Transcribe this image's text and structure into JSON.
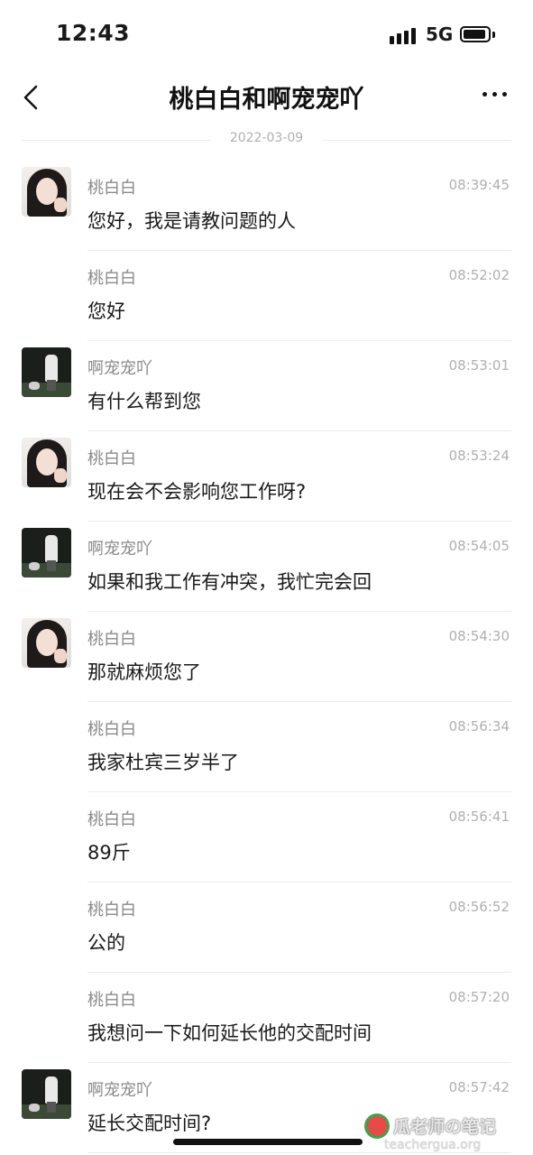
{
  "status_bar": {
    "time": "12:43",
    "network": "5G"
  },
  "header": {
    "title": "桃白白和啊宠宠吖"
  },
  "date_divider": "2022-03-09",
  "messages": [
    {
      "sender": "桃白白",
      "time": "08:39:45",
      "text": "您好，我是请教问题的人",
      "avatar": "a"
    },
    {
      "sender": "桃白白",
      "time": "08:52:02",
      "text": "您好",
      "avatar": ""
    },
    {
      "sender": "啊宠宠吖",
      "time": "08:53:01",
      "text": "有什么帮到您",
      "avatar": "b"
    },
    {
      "sender": "桃白白",
      "time": "08:53:24",
      "text": "现在会不会影响您工作呀?",
      "avatar": "a"
    },
    {
      "sender": "啊宠宠吖",
      "time": "08:54:05",
      "text": "如果和我工作有冲突，我忙完会回",
      "avatar": "b"
    },
    {
      "sender": "桃白白",
      "time": "08:54:30",
      "text": "那就麻烦您了",
      "avatar": "a"
    },
    {
      "sender": "桃白白",
      "time": "08:56:34",
      "text": "我家杜宾三岁半了",
      "avatar": ""
    },
    {
      "sender": "桃白白",
      "time": "08:56:41",
      "text": "89斤",
      "avatar": ""
    },
    {
      "sender": "桃白白",
      "time": "08:56:52",
      "text": "公的",
      "avatar": ""
    },
    {
      "sender": "桃白白",
      "time": "08:57:20",
      "text": "我想问一下如何延长他的交配时间",
      "avatar": ""
    },
    {
      "sender": "啊宠宠吖",
      "time": "08:57:42",
      "text": "延长交配时间?",
      "avatar": "b"
    }
  ],
  "watermark": {
    "title": "瓜老师の笔记",
    "url": "teachergua.org"
  }
}
